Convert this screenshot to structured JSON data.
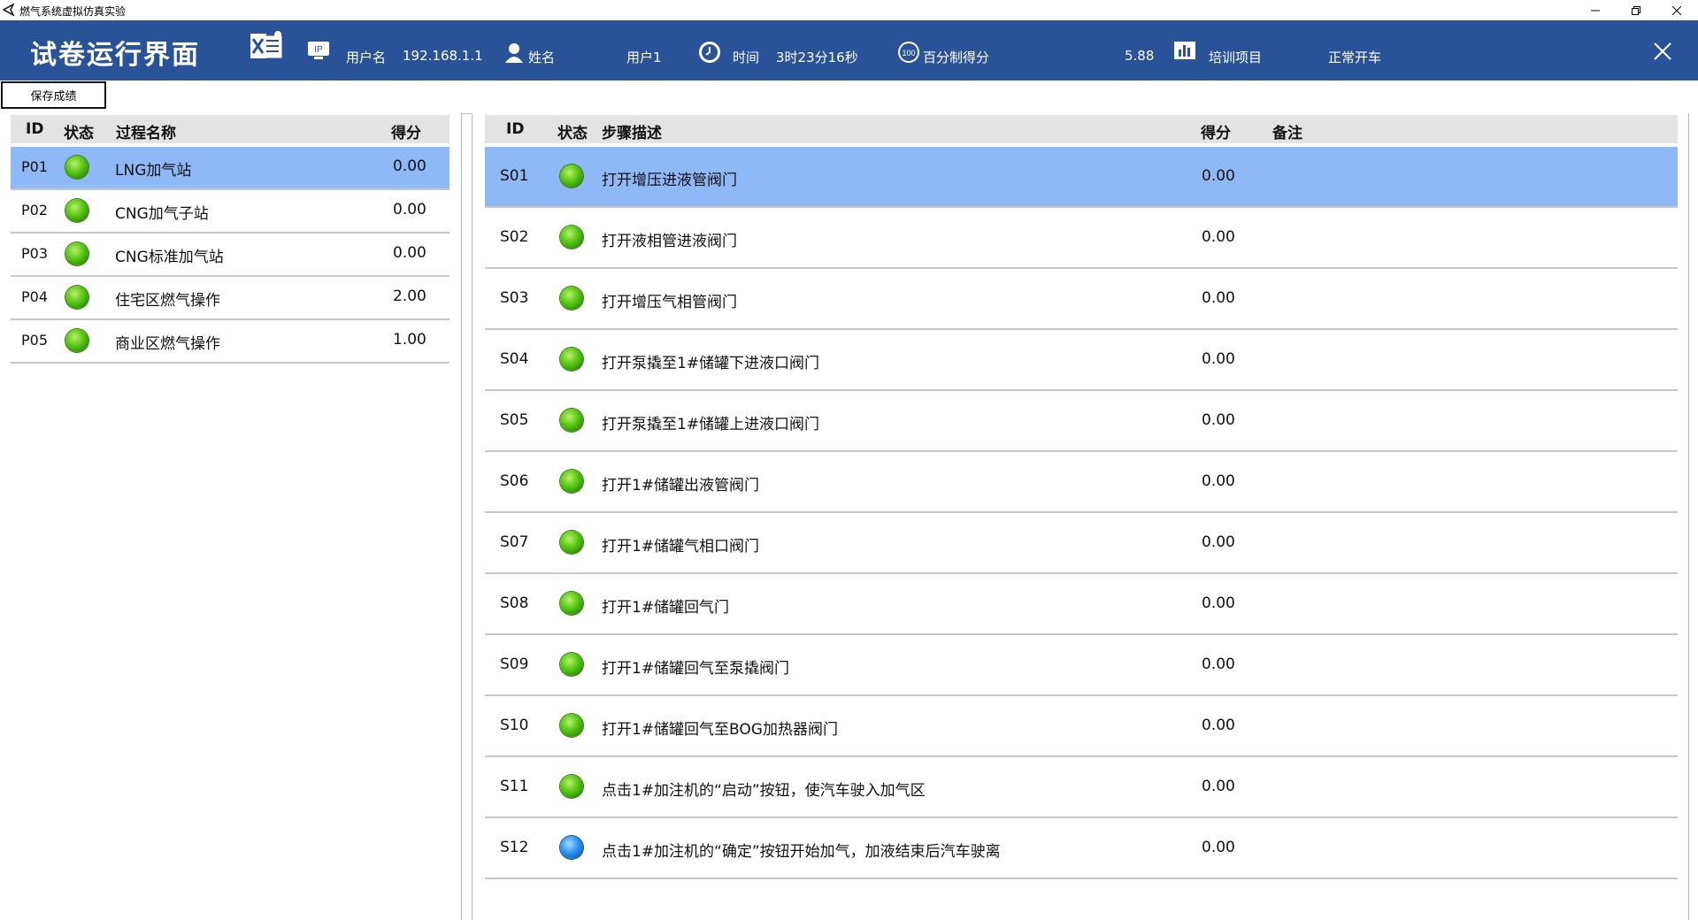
{
  "window": {
    "title": "燃气系统虚拟仿真实验"
  },
  "header": {
    "page_title": "试卷运行界面",
    "ip_label": "用户名",
    "ip_value": "192.168.1.1",
    "name_label": "姓名",
    "name_value": "用户1",
    "time_label": "时间",
    "time_value": "3时23分16秒",
    "score_label": "百分制得分",
    "score_value": "5.88",
    "project_label": "培训项目",
    "project_value": "正常开车",
    "icons": {
      "excel": "excel-export-icon",
      "ip": "ip-icon",
      "user": "user-icon",
      "clock": "clock-icon",
      "score": "score-100-icon",
      "chart": "bar-chart-icon",
      "close": "close-icon"
    }
  },
  "toolbar": {
    "save_label": "保存成绩"
  },
  "processes": {
    "columns": [
      "ID",
      "状态",
      "过程名称",
      "得分"
    ],
    "rows": [
      {
        "id": "P01",
        "status": "green",
        "name": "LNG加气站",
        "score": "0.00",
        "selected": true
      },
      {
        "id": "P02",
        "status": "green",
        "name": "CNG加气子站",
        "score": "0.00",
        "selected": false
      },
      {
        "id": "P03",
        "status": "green",
        "name": "CNG标准加气站",
        "score": "0.00",
        "selected": false
      },
      {
        "id": "P04",
        "status": "green",
        "name": "住宅区燃气操作",
        "score": "2.00",
        "selected": false
      },
      {
        "id": "P05",
        "status": "green",
        "name": "商业区燃气操作",
        "score": "1.00",
        "selected": false
      }
    ]
  },
  "steps": {
    "columns": [
      "ID",
      "状态",
      "步骤描述",
      "得分",
      "备注"
    ],
    "rows": [
      {
        "id": "S01",
        "status": "green",
        "desc": "打开增压进液管阀门",
        "score": "0.00",
        "note": "",
        "selected": true
      },
      {
        "id": "S02",
        "status": "green",
        "desc": "打开液相管进液阀门",
        "score": "0.00",
        "note": "",
        "selected": false
      },
      {
        "id": "S03",
        "status": "green",
        "desc": "打开增压气相管阀门",
        "score": "0.00",
        "note": "",
        "selected": false
      },
      {
        "id": "S04",
        "status": "green",
        "desc": "打开泵撬至1#储罐下进液口阀门",
        "score": "0.00",
        "note": "",
        "selected": false
      },
      {
        "id": "S05",
        "status": "green",
        "desc": "打开泵撬至1#储罐上进液口阀门",
        "score": "0.00",
        "note": "",
        "selected": false
      },
      {
        "id": "S06",
        "status": "green",
        "desc": "打开1#储罐出液管阀门",
        "score": "0.00",
        "note": "",
        "selected": false
      },
      {
        "id": "S07",
        "status": "green",
        "desc": "打开1#储罐气相口阀门",
        "score": "0.00",
        "note": "",
        "selected": false
      },
      {
        "id": "S08",
        "status": "green",
        "desc": "打开1#储罐回气门",
        "score": "0.00",
        "note": "",
        "selected": false
      },
      {
        "id": "S09",
        "status": "green",
        "desc": "打开1#储罐回气至泵撬阀门",
        "score": "0.00",
        "note": "",
        "selected": false
      },
      {
        "id": "S10",
        "status": "green",
        "desc": "打开1#储罐回气至BOG加热器阀门",
        "score": "0.00",
        "note": "",
        "selected": false
      },
      {
        "id": "S11",
        "status": "green",
        "desc": "点击1#加注机的“启动”按钮，使汽车驶入加气区",
        "score": "0.00",
        "note": "",
        "selected": false
      },
      {
        "id": "S12",
        "status": "blue",
        "desc": "点击1#加注机的“确定”按钮开始加气，加液结束后汽车驶离",
        "score": "0.00",
        "note": "",
        "selected": false
      }
    ]
  }
}
